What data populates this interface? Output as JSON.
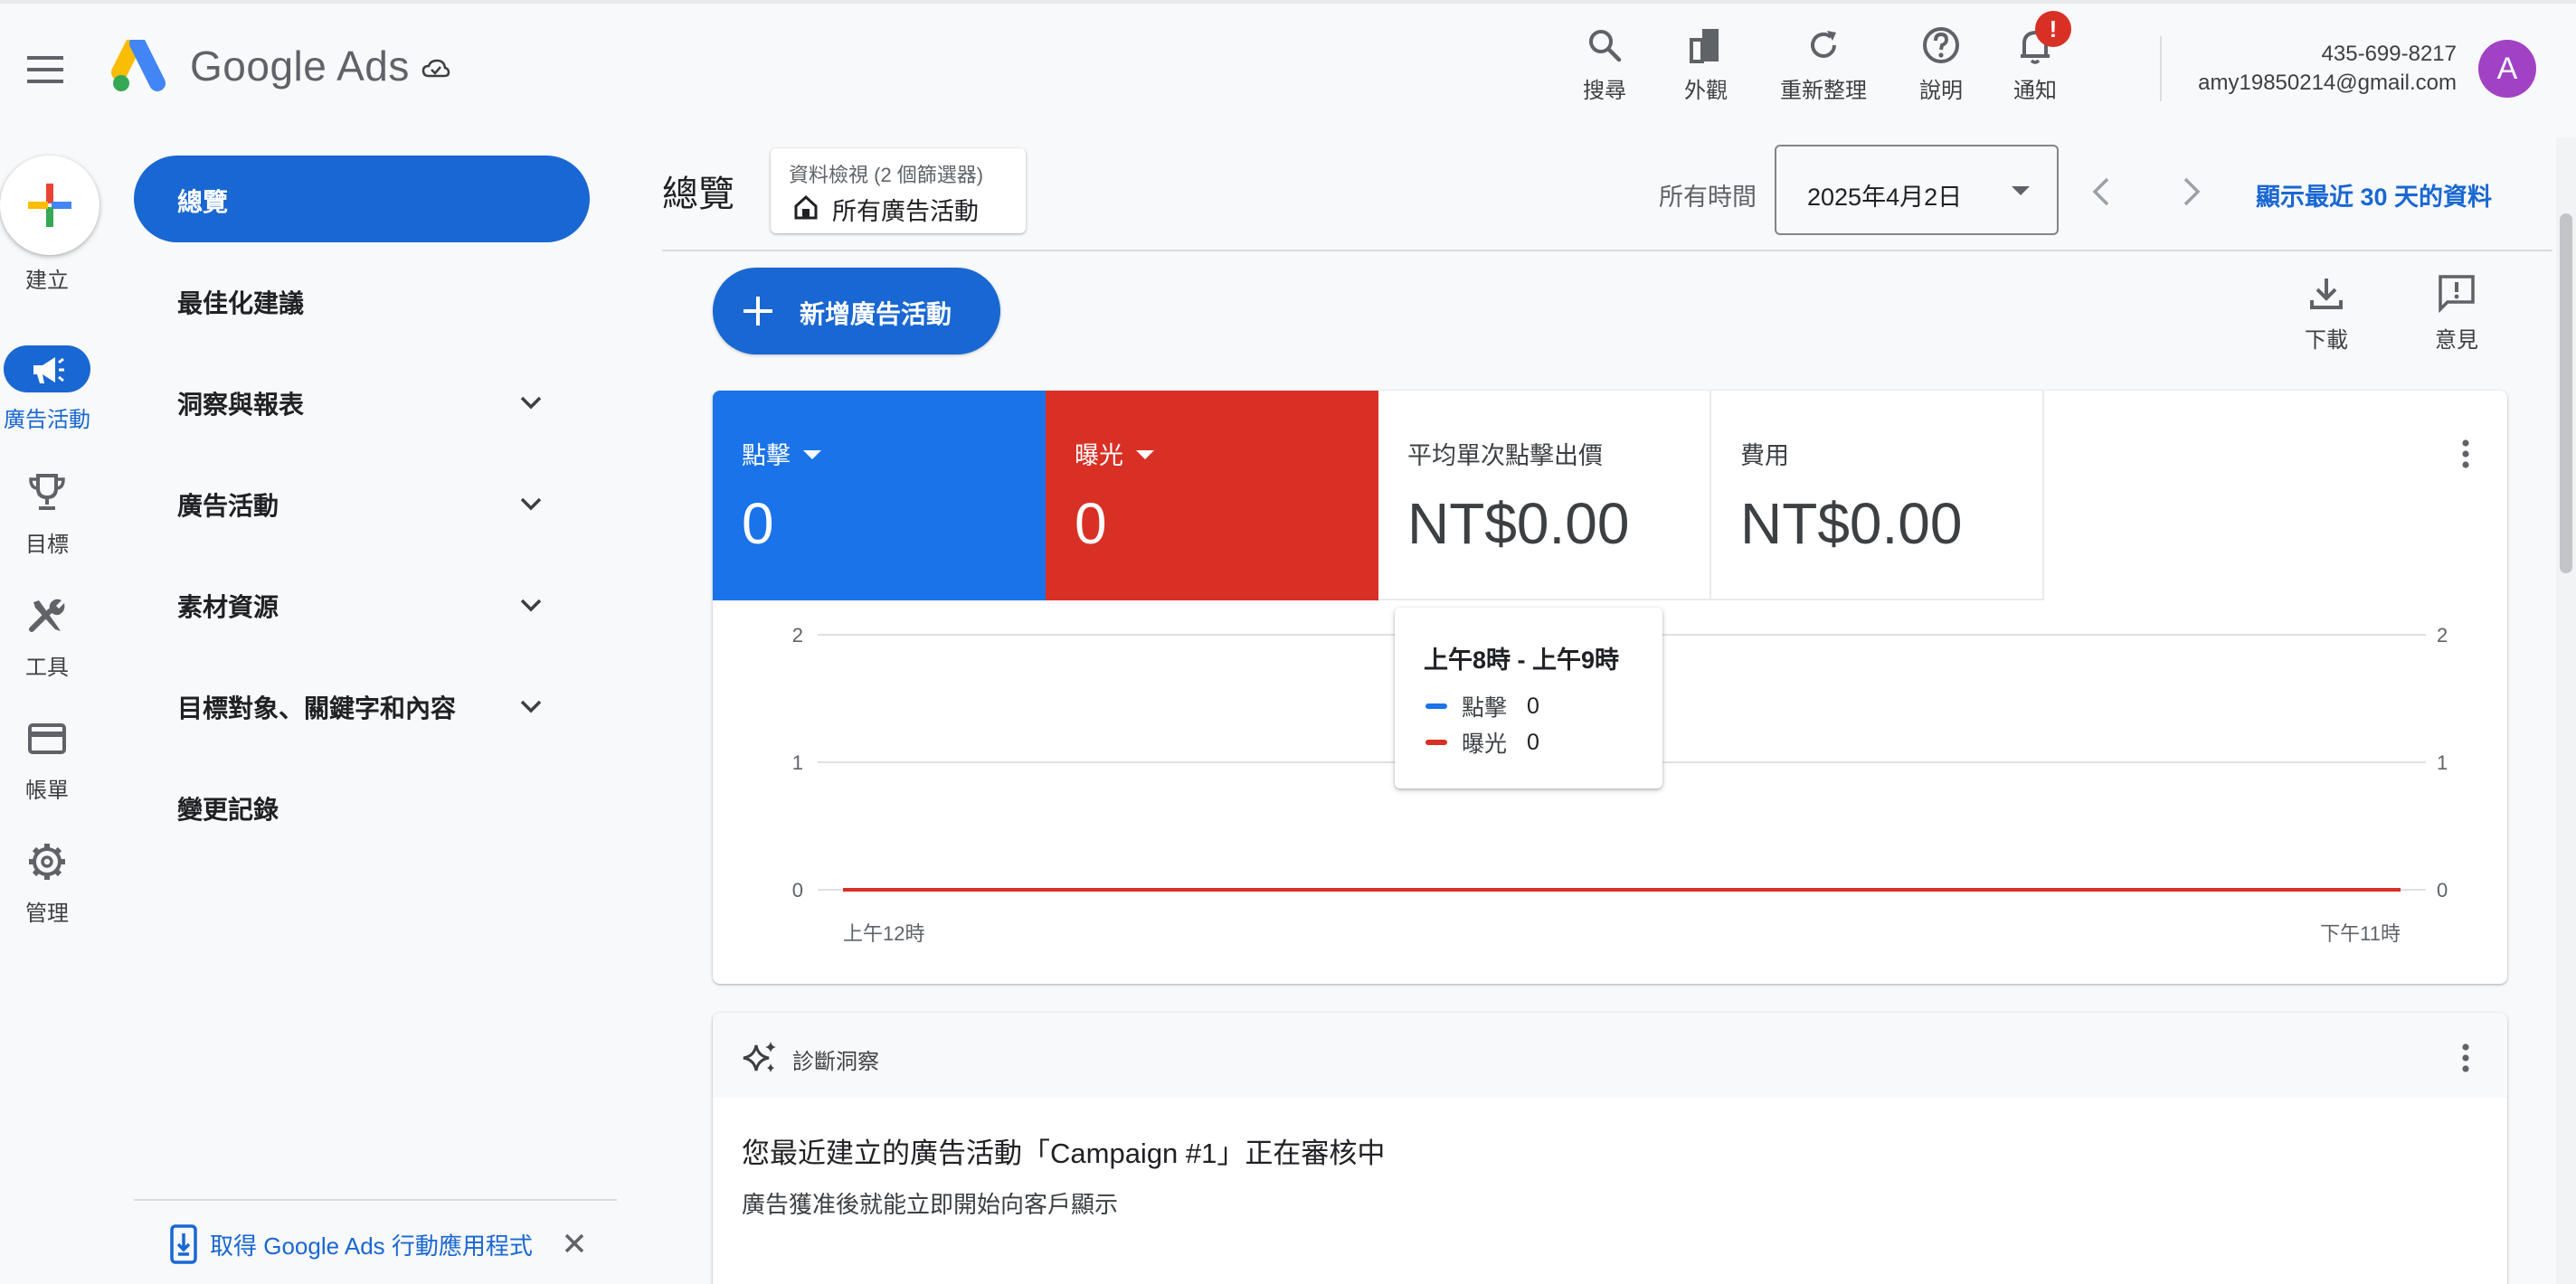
{
  "header": {
    "brand": "Google Ads",
    "actions": [
      {
        "label": "搜尋",
        "icon": "search-icon"
      },
      {
        "label": "外觀",
        "icon": "appearance-icon"
      },
      {
        "label": "重新整理",
        "icon": "refresh-icon"
      },
      {
        "label": "說明",
        "icon": "help-icon"
      },
      {
        "label": "通知",
        "icon": "bell-icon"
      }
    ],
    "notification_badge": "!",
    "account": {
      "phone": "435-699-8217",
      "email": "amy19850214@gmail.com",
      "avatar_letter": "A"
    }
  },
  "rail": {
    "create_label": "建立",
    "items": [
      {
        "label": "廣告活動",
        "icon": "megaphone-icon",
        "active": true
      },
      {
        "label": "目標",
        "icon": "trophy-icon"
      },
      {
        "label": "工具",
        "icon": "tools-icon"
      },
      {
        "label": "帳單",
        "icon": "credit-card-icon"
      },
      {
        "label": "管理",
        "icon": "gear-icon"
      }
    ]
  },
  "nav": {
    "items": [
      {
        "label": "總覽",
        "active": true,
        "expandable": false
      },
      {
        "label": "最佳化建議",
        "expandable": false
      },
      {
        "label": "洞察與報表",
        "expandable": true
      },
      {
        "label": "廣告活動",
        "expandable": true
      },
      {
        "label": "素材資源",
        "expandable": true
      },
      {
        "label": "目標對象、關鍵字和內容",
        "expandable": true
      },
      {
        "label": "變更記錄",
        "expandable": false
      }
    ],
    "promo_text": "取得 Google Ads 行動應用程式"
  },
  "page": {
    "title": "總覽",
    "filter_chip": {
      "sub": "資料檢視 (2 個篩選器)",
      "main": "所有廣告活動"
    },
    "time_label": "所有時間",
    "date_value": "2025年4月2日",
    "show_recent": "顯示最近 30 天的資料",
    "new_campaign": "新增廣告活動",
    "download_label": "下載",
    "feedback_label": "意見"
  },
  "metrics": [
    {
      "name": "點擊",
      "value": "0",
      "color": "#1a73e8",
      "dropdown": true
    },
    {
      "name": "曝光",
      "value": "0",
      "color": "#d93025",
      "dropdown": true
    },
    {
      "name": "平均單次點擊出價",
      "value": "NT$0.00"
    },
    {
      "name": "費用",
      "value": "NT$0.00"
    }
  ],
  "chart_data": {
    "type": "line",
    "x_tick_labels": [
      "上午12時",
      "下午11時"
    ],
    "y_ticks_left": [
      0,
      1,
      2
    ],
    "y_ticks_right": [
      0,
      1,
      2
    ],
    "ylim": [
      0,
      2
    ],
    "grid": true,
    "series": [
      {
        "name": "點擊",
        "color": "#1a73e8",
        "values": [
          0,
          0
        ]
      },
      {
        "name": "曝光",
        "color": "#d93025",
        "values": [
          0,
          0
        ]
      }
    ],
    "tooltip": {
      "title": "上午8時 - 上午9時",
      "rows": [
        {
          "name": "點擊",
          "value": "0",
          "color": "#1a73e8"
        },
        {
          "name": "曝光",
          "value": "0",
          "color": "#d93025"
        }
      ]
    }
  },
  "insights": {
    "header": "診斷洞察",
    "title": "您最近建立的廣告活動「Campaign #1」正在審核中",
    "description": "廣告獲准後就能立即開始向客戶顯示"
  }
}
